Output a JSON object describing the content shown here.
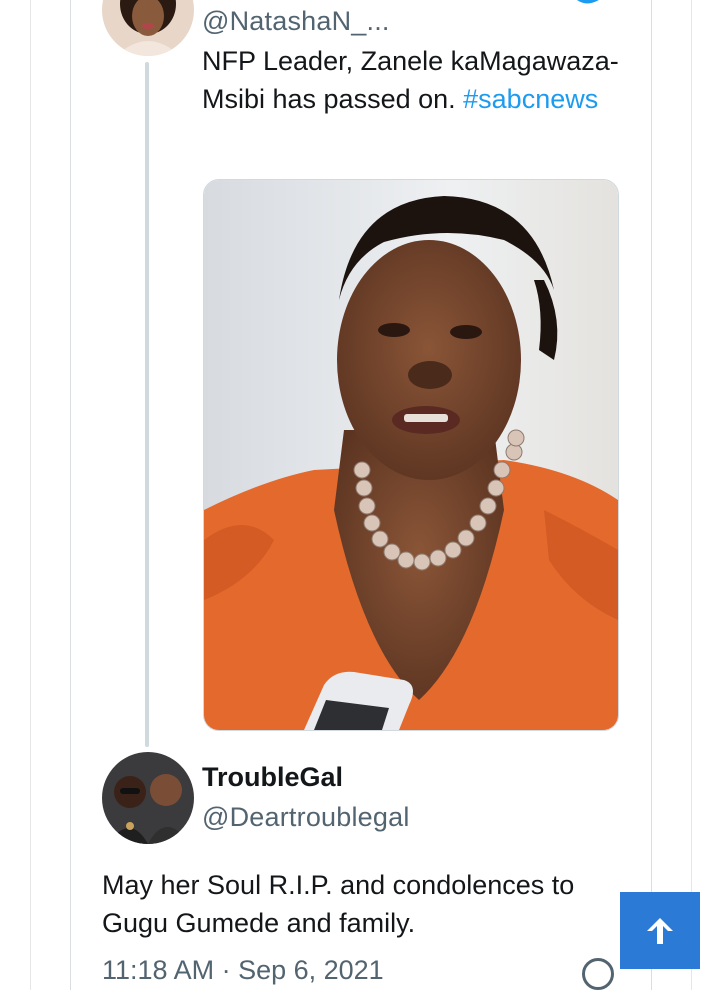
{
  "quoted_tweet": {
    "handle": "@NatashaN_...",
    "text_before_hashtag": "NFP Leader, Zanele kaMagawaza-Msibi has passed on. ",
    "hashtag": "#sabcnews",
    "avatar_icon": "avatar-natasha",
    "bird_icon": "twitter-bird-icon"
  },
  "reply_tweet": {
    "name": "TroubleGal",
    "handle": "@Deartroublegal",
    "text": "May her Soul R.I.P. and condolences to Gugu Gumede and family.",
    "timestamp": "11:18 AM · Sep 6, 2021"
  },
  "scroll_top_button": {
    "icon": "arrow-up-icon",
    "color": "#2a7ad6"
  },
  "colors": {
    "link": "#1d9bf0",
    "text": "#14171a",
    "secondary": "#536471"
  }
}
